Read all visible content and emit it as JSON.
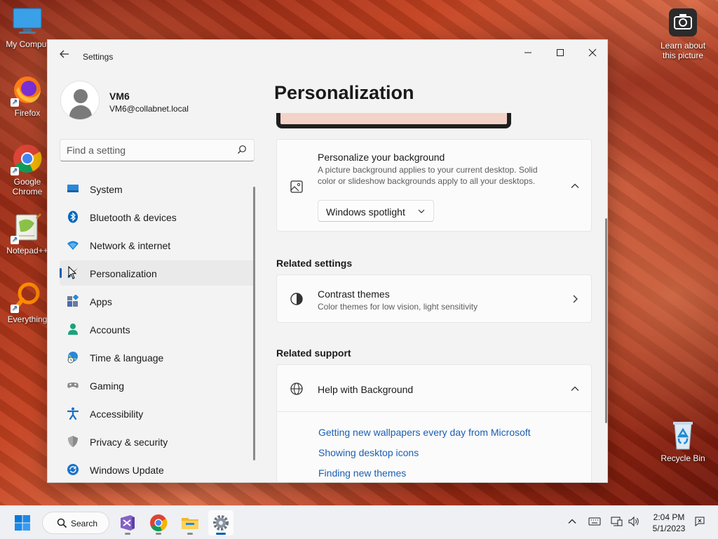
{
  "desktop": {
    "icons": [
      {
        "label": "My Comput"
      },
      {
        "label": "Firefox"
      },
      {
        "label": "Google Chrome"
      },
      {
        "label": "Notepad++"
      },
      {
        "label": "Everything"
      },
      {
        "label": "Learn about this picture"
      },
      {
        "label": "Recycle Bin"
      }
    ]
  },
  "window": {
    "title": "Settings",
    "controls": {
      "minimize": "—",
      "maximize": "☐",
      "close": "✕"
    }
  },
  "profile": {
    "name": "VM6",
    "email": "VM6@collabnet.local"
  },
  "search": {
    "placeholder": "Find a setting"
  },
  "nav": {
    "items": [
      {
        "label": "System",
        "icon": "monitor-icon",
        "color": "#2b88d8"
      },
      {
        "label": "Bluetooth & devices",
        "icon": "bluetooth-icon",
        "color": "#0067c0"
      },
      {
        "label": "Network & internet",
        "icon": "wifi-icon",
        "color": "#1a86d9"
      },
      {
        "label": "Personalization",
        "icon": "brush-icon",
        "color": "#6b6b6b",
        "active": true
      },
      {
        "label": "Apps",
        "icon": "apps-icon",
        "color": "#4a6cb3"
      },
      {
        "label": "Accounts",
        "icon": "person-icon",
        "color": "#1aa37a"
      },
      {
        "label": "Time & language",
        "icon": "globe-clock-icon",
        "color": "#2a86d9"
      },
      {
        "label": "Gaming",
        "icon": "gamepad-icon",
        "color": "#7a7a7a"
      },
      {
        "label": "Accessibility",
        "icon": "accessibility-icon",
        "color": "#1a6fc9"
      },
      {
        "label": "Privacy & security",
        "icon": "shield-icon",
        "color": "#6d6d6d"
      },
      {
        "label": "Windows Update",
        "icon": "update-icon",
        "color": "#1a73c9"
      }
    ]
  },
  "content": {
    "page_title": "Personalization",
    "background_card": {
      "title": "Personalize your background",
      "description": "A picture background applies to your current desktop. Solid color or slideshow backgrounds apply to all your desktops.",
      "dropdown_value": "Windows spotlight"
    },
    "related_settings": {
      "heading": "Related settings",
      "contrast": {
        "title": "Contrast themes",
        "description": "Color themes for low vision, light sensitivity"
      }
    },
    "related_support": {
      "heading": "Related support",
      "help": {
        "title": "Help with Background"
      },
      "links": [
        "Getting new wallpapers every day from Microsoft",
        "Showing desktop icons",
        "Finding new themes"
      ]
    }
  },
  "taskbar": {
    "search_label": "Search",
    "clock": {
      "time": "2:04 PM",
      "date": "5/1/2023"
    },
    "accent": "#005fb8"
  }
}
